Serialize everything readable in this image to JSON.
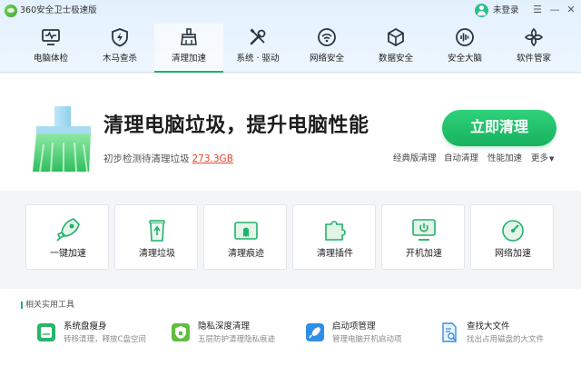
{
  "window": {
    "title": "360安全卫士极速版",
    "user_status": "未登录",
    "buttons": {
      "menu": "☰",
      "minimize": "—",
      "close": "✕"
    }
  },
  "nav": {
    "items": [
      {
        "label": "电脑体检",
        "icon": "monitor-pulse-icon",
        "active": false
      },
      {
        "label": "木马查杀",
        "icon": "shield-bolt-icon",
        "active": false
      },
      {
        "label": "清理加速",
        "icon": "broom-icon",
        "active": true
      },
      {
        "label": "系统 · 驱动",
        "icon": "tools-icon",
        "active": false
      },
      {
        "label": "网络安全",
        "icon": "wifi-icon",
        "active": false
      },
      {
        "label": "数据安全",
        "icon": "cube-icon",
        "active": false
      },
      {
        "label": "安全大脑",
        "icon": "brain-wave-icon",
        "active": false
      },
      {
        "label": "软件管家",
        "icon": "flower-grid-icon",
        "active": false
      }
    ]
  },
  "hero": {
    "headline": "清理电脑垃圾，提升电脑性能",
    "subline": "初步检测待清理垃圾",
    "junk_size": "273.3GB",
    "clean_button": "立即清理",
    "links": [
      "经典版清理",
      "自动清理",
      "性能加速",
      "更多"
    ]
  },
  "tools": [
    {
      "label": "一键加速",
      "icon": "rocket-icon"
    },
    {
      "label": "清理垃圾",
      "icon": "recycle-bin-icon"
    },
    {
      "label": "清理痕迹",
      "icon": "ghost-folder-icon"
    },
    {
      "label": "清理插件",
      "icon": "puzzle-icon"
    },
    {
      "label": "开机加速",
      "icon": "power-monitor-icon"
    },
    {
      "label": "网络加速",
      "icon": "speedometer-icon"
    }
  ],
  "related": {
    "title": "相关实用工具",
    "items": [
      {
        "name": "系统盘瘦身",
        "desc": "转移清理，释放C盘空间",
        "icon": "disk-icon"
      },
      {
        "name": "隐私深度清理",
        "desc": "五层防护清理隐私痕迹",
        "icon": "privacy-shield-icon"
      },
      {
        "name": "启动项管理",
        "desc": "管理电脑开机启动项",
        "icon": "rocket-manage-icon"
      },
      {
        "name": "查找大文件",
        "desc": "找出占用磁盘的大文件",
        "icon": "file-search-icon"
      }
    ]
  },
  "colors": {
    "accent_green": "#21b26b",
    "junk_red": "#e6452f",
    "topbar_bg": "#e3f1fd"
  }
}
